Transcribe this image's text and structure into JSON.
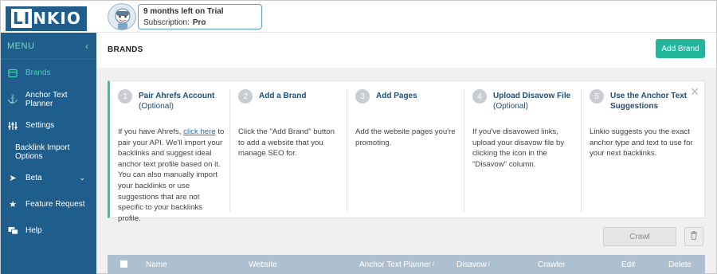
{
  "logo": {
    "text_a": "LI",
    "text_b": "NKIO"
  },
  "trial": {
    "line1": "9 months left on Trial",
    "line2_label": "Subscription:",
    "line2_value": "Pro"
  },
  "sidebar": {
    "menu_label": "MENU",
    "items": [
      {
        "label": "Brands",
        "icon": "brands-icon",
        "active": true
      },
      {
        "label": "Anchor Text Planner",
        "icon": "anchor-icon"
      },
      {
        "label": "Settings",
        "icon": "settings-sliders-icon"
      },
      {
        "label": "Backlink Import Options",
        "icon": ""
      },
      {
        "label": "Beta",
        "icon": "rocket-icon"
      },
      {
        "label": "Feature Request",
        "icon": "star-icon"
      },
      {
        "label": "Help",
        "icon": "help-chat-icon"
      }
    ]
  },
  "header": {
    "title": "BRANDS",
    "add_brand": "Add Brand"
  },
  "steps": [
    {
      "num": "1",
      "title": "Pair Ahrefs Account",
      "optional": "(Optional)",
      "body_pre": "If you have Ahrefs, ",
      "link": "click here",
      "body_post": " to pair your API. We'll import your backlinks and suggest ideal anchor text profile based on it. You can also manually import your backlinks or use suggestions that are not specific to your backlinks profile."
    },
    {
      "num": "2",
      "title": "Add a Brand",
      "optional": "",
      "body": "Click the \"Add Brand\" button to add a website that you manage SEO for."
    },
    {
      "num": "3",
      "title": "Add Pages",
      "optional": "",
      "body": "Add the website pages you're promoting."
    },
    {
      "num": "4",
      "title": "Upload Disavow File",
      "optional": "(Optional)",
      "body": "If you've disavowed links, upload your disavow file by clicking the icon in the \"Disavow\" column."
    },
    {
      "num": "5",
      "title": "Use the Anchor Text Suggestions",
      "optional": "",
      "body": "Linkio suggests you the exact anchor type and text to use for your next backlinks."
    }
  ],
  "actions": {
    "crawl": "Crawl"
  },
  "table": {
    "columns": [
      "Name",
      "Website",
      "Anchor Text Planner",
      "Disavow",
      "Crawler",
      "Edit",
      "Delete"
    ],
    "info_mark": "i"
  }
}
